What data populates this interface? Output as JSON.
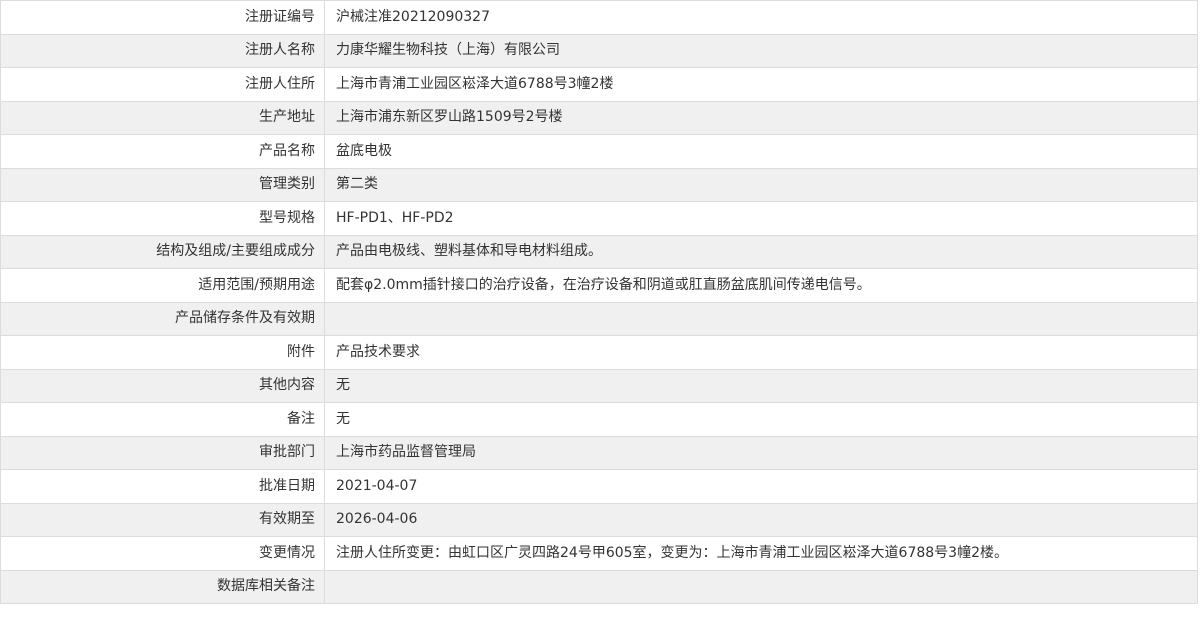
{
  "rows": [
    {
      "label": "注册证编号",
      "value": "沪械注准20212090327"
    },
    {
      "label": "注册人名称",
      "value": "力康华耀生物科技（上海）有限公司"
    },
    {
      "label": "注册人住所",
      "value": "上海市青浦工业园区崧泽大道6788号3幢2楼"
    },
    {
      "label": "生产地址",
      "value": "上海市浦东新区罗山路1509号2号楼"
    },
    {
      "label": "产品名称",
      "value": "盆底电极"
    },
    {
      "label": "管理类别",
      "value": "第二类"
    },
    {
      "label": "型号规格",
      "value": "HF-PD1、HF-PD2"
    },
    {
      "label": "结构及组成/主要组成成分",
      "value": "产品由电极线、塑料基体和导电材料组成。"
    },
    {
      "label": "适用范围/预期用途",
      "value": "配套φ2.0mm插针接口的治疗设备，在治疗设备和阴道或肛直肠盆底肌间传递电信号。"
    },
    {
      "label": "产品储存条件及有效期",
      "value": ""
    },
    {
      "label": "附件",
      "value": "产品技术要求"
    },
    {
      "label": "其他内容",
      "value": "无"
    },
    {
      "label": "备注",
      "value": "无"
    },
    {
      "label": "审批部门",
      "value": "上海市药品监督管理局"
    },
    {
      "label": "批准日期",
      "value": "2021-04-07"
    },
    {
      "label": "有效期至",
      "value": "2026-04-06"
    },
    {
      "label": "变更情况",
      "value": "注册人住所变更：由虹口区广灵四路24号甲605室，变更为：上海市青浦工业园区崧泽大道6788号3幢2楼。"
    },
    {
      "label": "数据库相关备注",
      "value": ""
    }
  ]
}
